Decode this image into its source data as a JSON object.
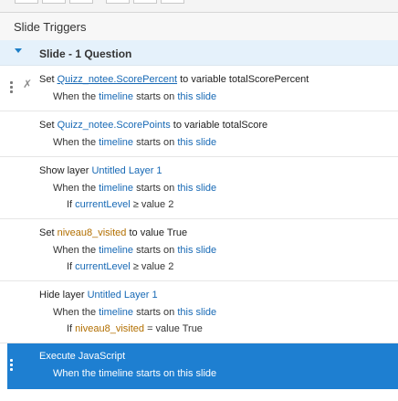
{
  "panel": {
    "title": "Slide Triggers",
    "scene": "Slide - 1 Question"
  },
  "triggers": [
    {
      "w1": "Set ",
      "obj": "Quizz_notee.ScorePercent",
      "w2": " to variable ",
      "var": "totalScorePercent",
      "when1": "When the ",
      "when_obj": "timeline",
      "when2": " starts on ",
      "when3": "this slide"
    },
    {
      "w1": "Set ",
      "obj": "Quizz_notee.ScorePoints",
      "w2": " to variable ",
      "var": "totalScore",
      "when1": "When the ",
      "when_obj": "timeline",
      "when2": " starts on ",
      "when3": "this slide"
    },
    {
      "w1": "Show layer ",
      "obj": "Untitled Layer 1",
      "when1": "When the ",
      "when_obj": "timeline",
      "when2": " starts on ",
      "when3": "this slide",
      "if1": "If ",
      "if_var": "currentLevel",
      "if2": " ≥ value 2"
    },
    {
      "w1": "Set ",
      "obj": "niveau8_visited",
      "w2": " to value ",
      "val": "True",
      "when1": "When the ",
      "when_obj": "timeline",
      "when2": " starts on ",
      "when3": "this slide",
      "if1": "If ",
      "if_var": "currentLevel",
      "if2": " ≥ value 2"
    },
    {
      "w1": "Hide layer ",
      "obj": "Untitled Layer 1",
      "when1": "When the ",
      "when_obj": "timeline",
      "when2": " starts on ",
      "when3": "this slide",
      "if1": "If ",
      "if_var": "niveau8_visited",
      "if2": " = value ",
      "if_val": "True"
    },
    {
      "w1": "Execute JavaScript",
      "when1": "When the timeline starts on this slide"
    }
  ],
  "colors": {
    "link": "#1769b5",
    "variable": "#b26f00",
    "selected_bg": "#1e7fd1",
    "scene_bg": "#e5f1fb"
  },
  "icons": {
    "scene_toggle": "triangle-down-icon",
    "drag_handle": "grip-dots-icon",
    "trigger_marker": "pin-icon"
  }
}
